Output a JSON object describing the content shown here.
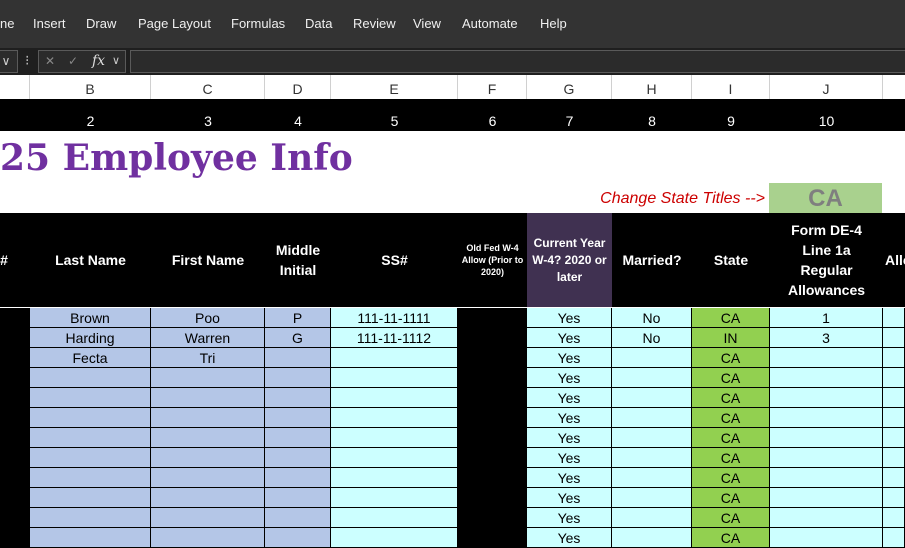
{
  "menu": {
    "items": [
      "ne",
      "Insert",
      "Draw",
      "Page Layout",
      "Formulas",
      "Data",
      "Review",
      "View",
      "Automate",
      "Help"
    ]
  },
  "formula_bar": {
    "name_box_chevron": "∨",
    "separator": "⁝",
    "cancel_icon": "✕",
    "enter_icon": "✓",
    "fx_label": "fx",
    "fx_chevron": "∨",
    "formula_value": ""
  },
  "columns": {
    "letters": [
      "B",
      "C",
      "D",
      "E",
      "F",
      "G",
      "H",
      "I",
      "J"
    ],
    "numbers": [
      "2",
      "3",
      "4",
      "5",
      "6",
      "7",
      "8",
      "9",
      "10"
    ]
  },
  "sheet": {
    "title": "25 Employee Info",
    "change_state_label": "Change State Titles -->",
    "state_value": "CA"
  },
  "headers": {
    "num": "#",
    "last_name": "Last Name",
    "first_name": "First Name",
    "middle_initial": "Middle Initial",
    "ssn": "SS#",
    "old_fed": "Old Fed W-4 Allow (Prior to 2020)",
    "current_year": "Current Year W-4? 2020 or later",
    "married": "Married?",
    "state": "State",
    "form_de4": "Form DE-4 Line 1a Regular Allowances",
    "allow_partial": "Allo"
  },
  "rows": [
    {
      "last": "Brown",
      "first": "Poo",
      "mi": "P",
      "ssn": "111-11-1111",
      "cur": "Yes",
      "mar": "No",
      "state": "CA",
      "de4": "1"
    },
    {
      "last": "Harding",
      "first": "Warren",
      "mi": "G",
      "ssn": "111-11-1112",
      "cur": "Yes",
      "mar": "No",
      "state": "IN",
      "de4": "3"
    },
    {
      "last": "Fecta",
      "first": "Tri",
      "mi": "",
      "ssn": "",
      "cur": "Yes",
      "mar": "",
      "state": "CA",
      "de4": ""
    },
    {
      "last": "",
      "first": "",
      "mi": "",
      "ssn": "",
      "cur": "Yes",
      "mar": "",
      "state": "CA",
      "de4": ""
    },
    {
      "last": "",
      "first": "",
      "mi": "",
      "ssn": "",
      "cur": "Yes",
      "mar": "",
      "state": "CA",
      "de4": ""
    },
    {
      "last": "",
      "first": "",
      "mi": "",
      "ssn": "",
      "cur": "Yes",
      "mar": "",
      "state": "CA",
      "de4": ""
    },
    {
      "last": "",
      "first": "",
      "mi": "",
      "ssn": "",
      "cur": "Yes",
      "mar": "",
      "state": "CA",
      "de4": ""
    },
    {
      "last": "",
      "first": "",
      "mi": "",
      "ssn": "",
      "cur": "Yes",
      "mar": "",
      "state": "CA",
      "de4": ""
    },
    {
      "last": "",
      "first": "",
      "mi": "",
      "ssn": "",
      "cur": "Yes",
      "mar": "",
      "state": "CA",
      "de4": ""
    },
    {
      "last": "",
      "first": "",
      "mi": "",
      "ssn": "",
      "cur": "Yes",
      "mar": "",
      "state": "CA",
      "de4": ""
    },
    {
      "last": "",
      "first": "",
      "mi": "",
      "ssn": "",
      "cur": "Yes",
      "mar": "",
      "state": "CA",
      "de4": ""
    },
    {
      "last": "",
      "first": "",
      "mi": "",
      "ssn": "",
      "cur": "Yes",
      "mar": "",
      "state": "CA",
      "de4": ""
    }
  ],
  "colors": {
    "menu_bg": "#333333",
    "title": "#7030a0",
    "name_fill": "#b4c6e7",
    "data_fill": "#ccffff",
    "state_fill": "#92d050",
    "state_box_fill": "#a9d18e",
    "current_year_header": "#403151",
    "red_label": "#cc0000"
  }
}
